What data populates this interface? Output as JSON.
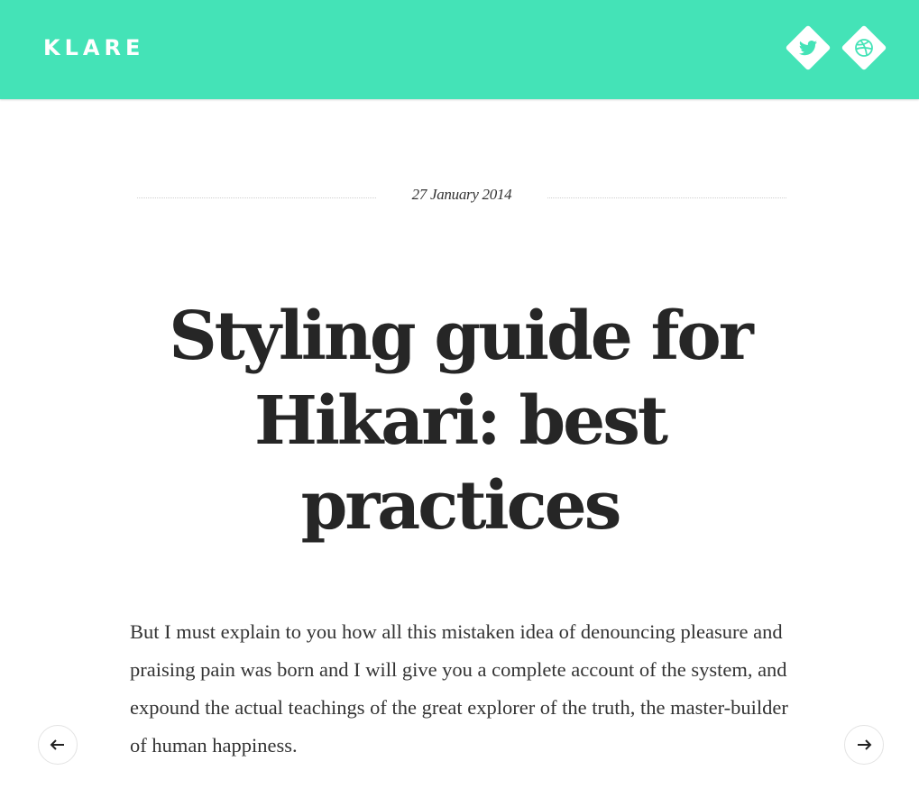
{
  "header": {
    "logo": "KLARE",
    "background_color": "#44e3b7",
    "social": [
      {
        "icon": "twitter-icon"
      },
      {
        "icon": "dribbble-icon"
      }
    ]
  },
  "post": {
    "date": "27 January 2014",
    "title": "Styling guide for Hikari: best practices",
    "body": "But I must explain to you how all this mistaken idea of denouncing pleasure and praising pain was born and I will give you a complete account of the system, and expound the actual teachings of the great explorer of the truth, the master-builder of human happiness."
  },
  "navigation": {
    "prev_icon": "arrow-left-icon",
    "next_icon": "arrow-right-icon"
  }
}
